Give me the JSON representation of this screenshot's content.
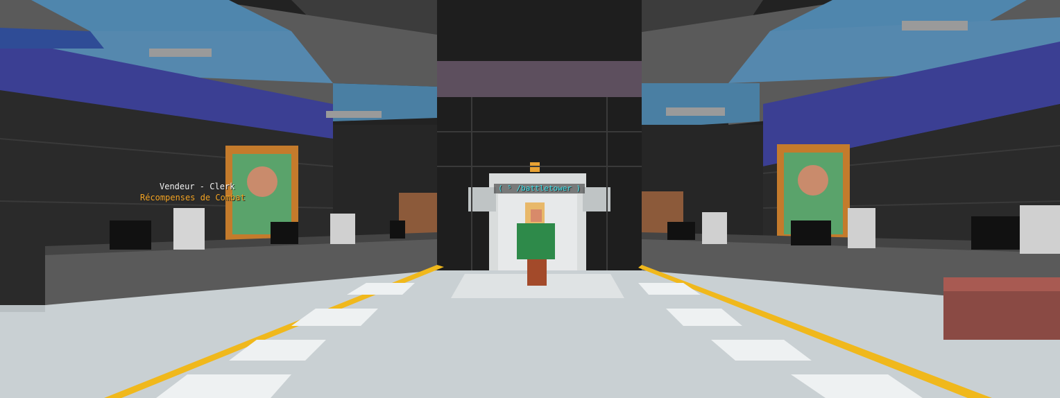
{
  "hud": {
    "npc_name": "Vendeur - Clerk",
    "npc_role": "Récompenses de Combat",
    "elevator_command": "( ⁵ /battletower )"
  },
  "colors": {
    "floor": "#c9d0d3",
    "yellow_line": "#f0b81c",
    "ceiling_blue": "#4a7fa3",
    "wall_dark": "#2a2a2a",
    "brick_blue": "#3b3f93",
    "counter": "#5a5a5a",
    "player_coat": "#2e8a4a"
  }
}
